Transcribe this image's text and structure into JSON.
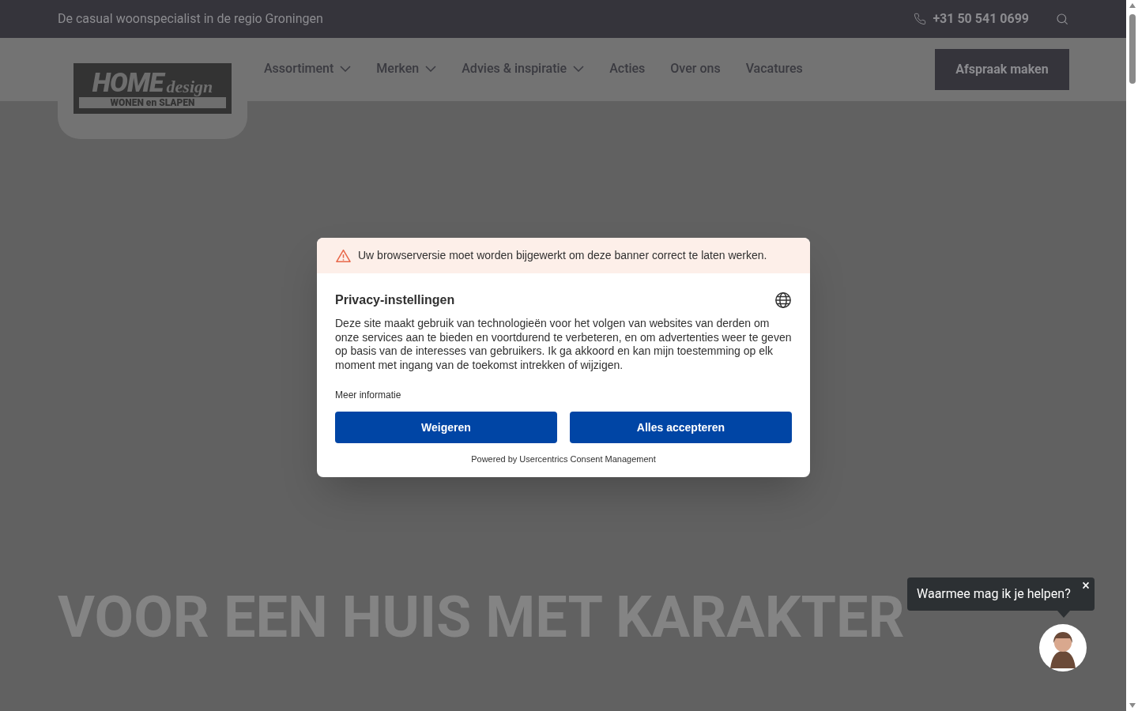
{
  "top_bar": {
    "tagline": "De casual woonspecialist in de regio Groningen",
    "phone": "+31 50 541 0699"
  },
  "logo": {
    "line_1": "HOME",
    "line_1b": "design",
    "line_2": "WONEN en SLAPEN"
  },
  "nav": {
    "items": [
      {
        "label": "Assortiment",
        "dropdown": true
      },
      {
        "label": "Merken",
        "dropdown": true
      },
      {
        "label": "Advies & inspiratie",
        "dropdown": true
      },
      {
        "label": "Acties",
        "dropdown": false
      },
      {
        "label": "Over ons",
        "dropdown": false
      },
      {
        "label": "Vacatures",
        "dropdown": false
      }
    ],
    "cta": "Afspraak maken"
  },
  "hero": {
    "heading": "VOOR EEN HUIS MET KARAKTER"
  },
  "consent": {
    "warning": "Uw browserversie moet worden bijgewerkt om deze banner correct te laten werken.",
    "title": "Privacy-instellingen",
    "body": "Deze site maakt gebruik van technologieën voor het volgen van websites van derden om onze services aan te bieden en voortdurend te verbeteren, en om advertenties weer te geven op basis van de interesses van gebruikers. Ik ga akkoord en kan mijn toestemming op elk moment met ingang van de toekomst intrekken of wijzigen.",
    "more_info": "Meer informatie",
    "buttons": [
      "Weigeren",
      "Alles accepteren"
    ],
    "footer": "Powered by Usercentrics Consent Management"
  },
  "chat": {
    "prompt": "Waarmee mag ik je helpen?",
    "close": "×"
  }
}
